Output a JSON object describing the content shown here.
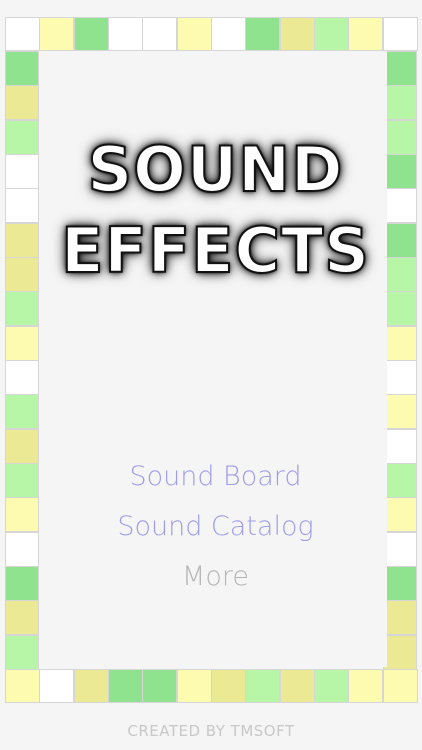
{
  "title": {
    "line1": "SOUND",
    "line2": "EFFECTS"
  },
  "menu": {
    "items": [
      {
        "label": "Sound Board"
      },
      {
        "label": "Sound Catalog"
      },
      {
        "label": "More"
      }
    ]
  },
  "footer": {
    "text": "CREATED BY TMSOFT"
  },
  "colors": {
    "white": "#ffffff",
    "yellow": "#fdfbb0",
    "green": "#8fe38f",
    "light_green": "#b7f5a7",
    "olive": "#ece995",
    "menu_active": "#9e9ee8",
    "menu_muted": "#b5b5b5"
  },
  "border": {
    "top": [
      "white",
      "yellow",
      "green",
      "white",
      "white",
      "yellow",
      "white",
      "green",
      "olive",
      "light_green",
      "yellow",
      "white"
    ],
    "left": [
      "green",
      "olive",
      "light_green",
      "white",
      "white",
      "olive",
      "olive",
      "light_green",
      "yellow",
      "white",
      "light_green",
      "olive",
      "light_green",
      "yellow",
      "white",
      "green",
      "olive",
      "light_green"
    ],
    "right": [
      "green",
      "light_green",
      "light_green",
      "green",
      "white",
      "green",
      "light_green",
      "light_green",
      "yellow",
      "white",
      "yellow",
      "white",
      "light_green",
      "yellow",
      "white",
      "green",
      "olive",
      "olive"
    ],
    "bottom": [
      "yellow",
      "white",
      "olive",
      "green",
      "green",
      "yellow",
      "olive",
      "light_green",
      "olive",
      "light_green",
      "yellow",
      "yellow"
    ]
  }
}
